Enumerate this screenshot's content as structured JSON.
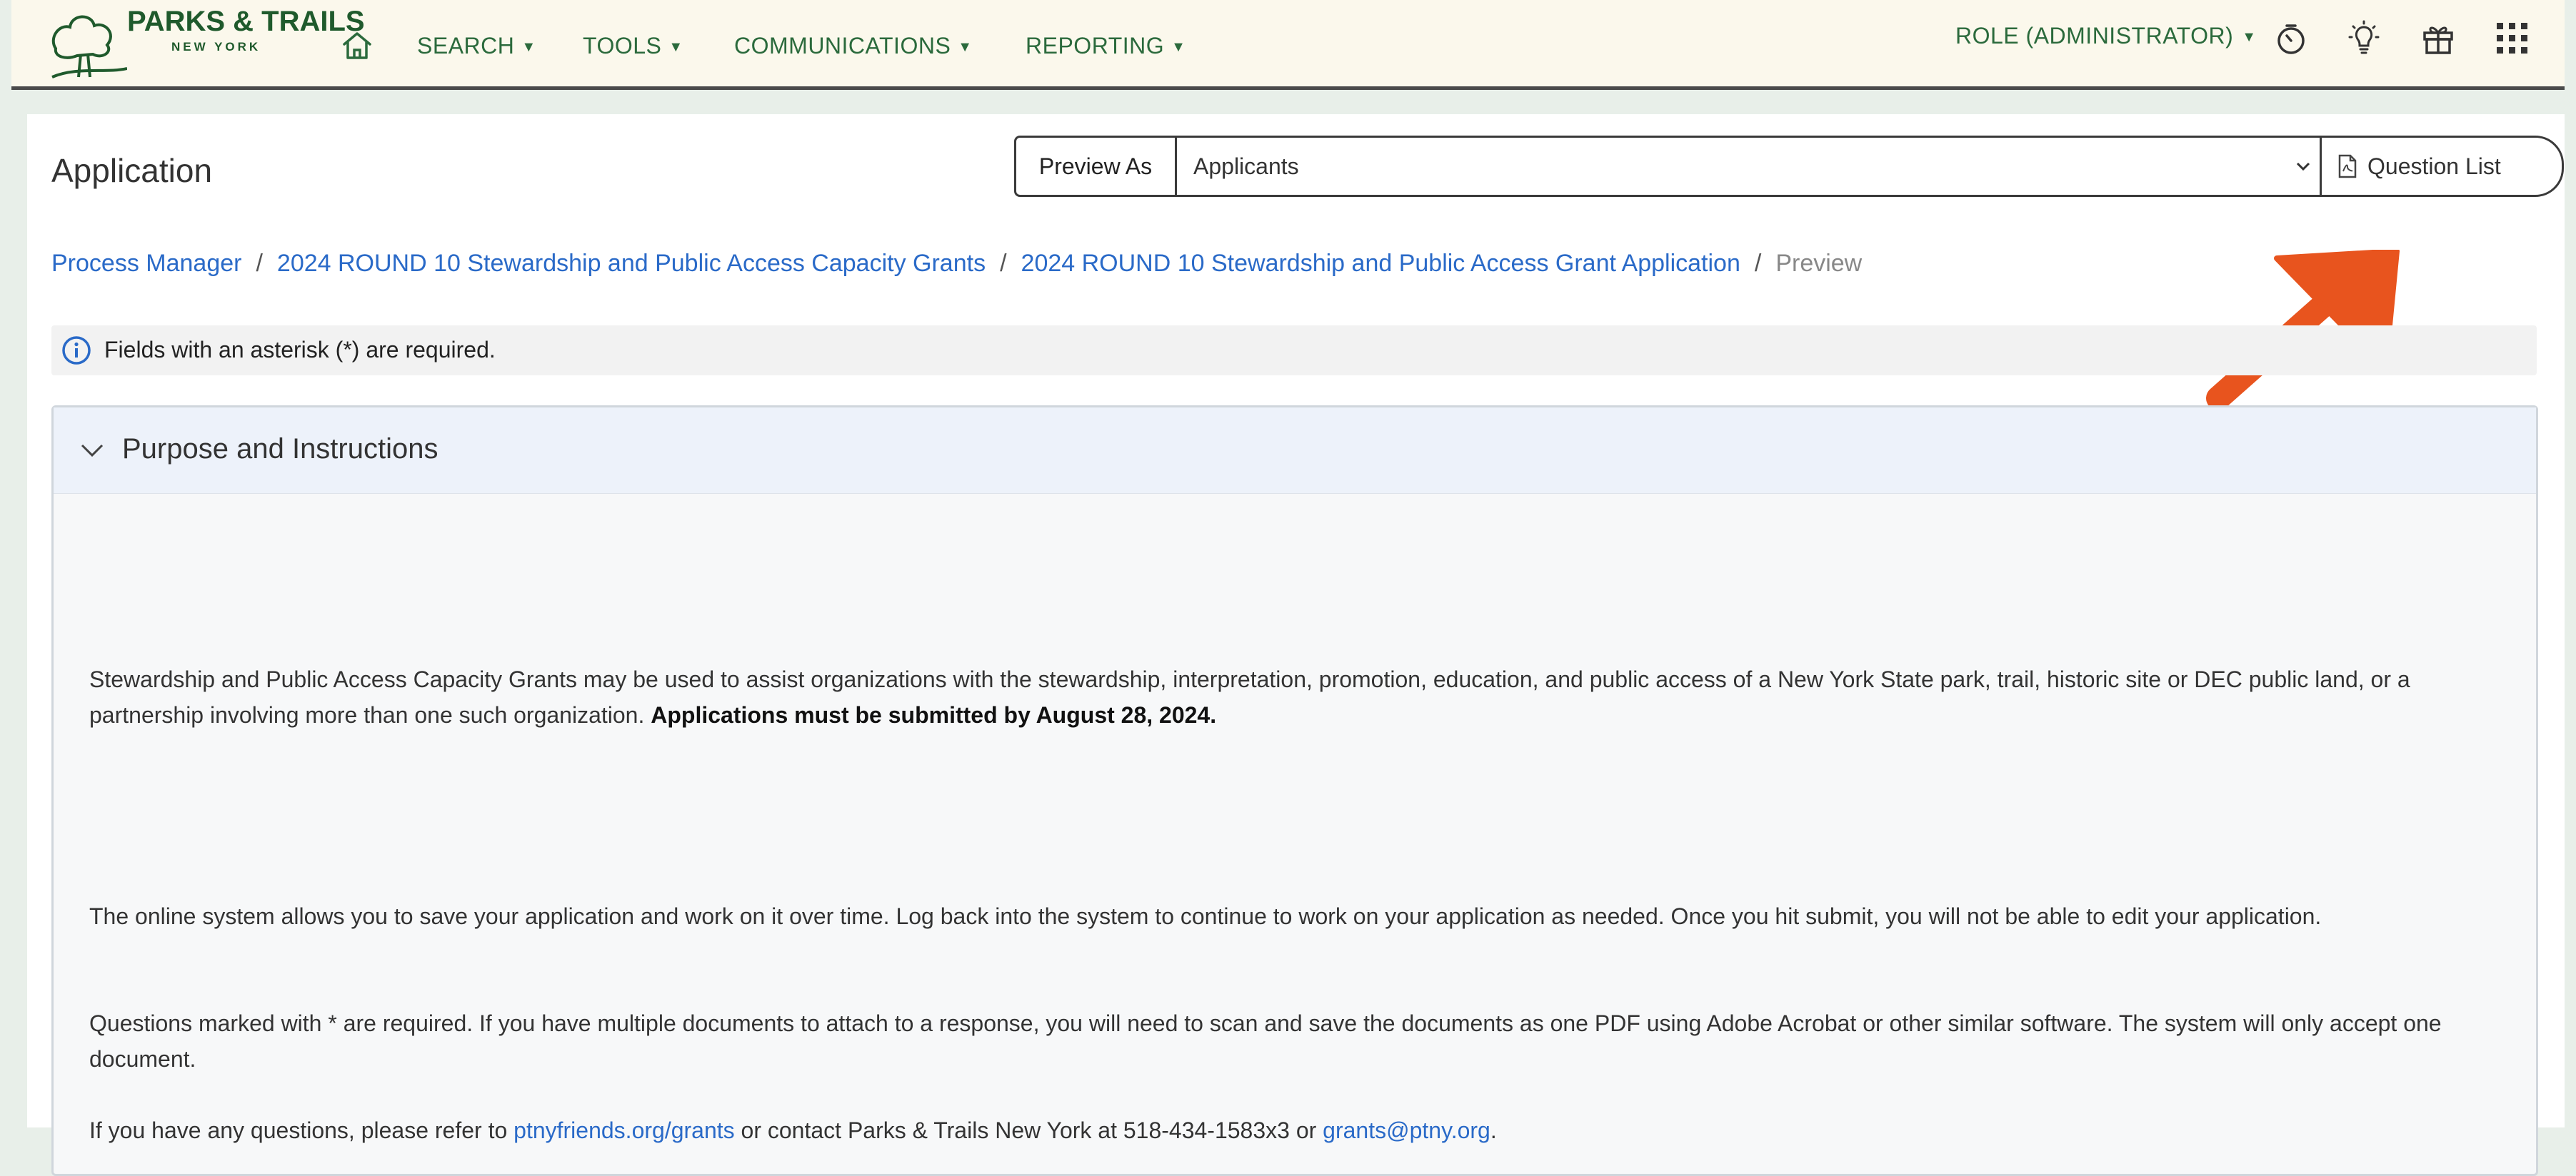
{
  "nav": {
    "logo_line1": "PARKS & TRAILS",
    "logo_line2": "NEW YORK",
    "items": [
      {
        "label": "SEARCH"
      },
      {
        "label": "TOOLS"
      },
      {
        "label": "COMMUNICATIONS"
      },
      {
        "label": "REPORTING"
      }
    ],
    "role_label": "ROLE (ADMINISTRATOR)",
    "icons": [
      "home-icon",
      "timer-icon",
      "lightbulb-icon",
      "gift-icon",
      "app-grid-icon"
    ]
  },
  "page": {
    "title": "Application",
    "preview_as_label": "Preview As",
    "preview_as_value": "Applicants",
    "question_list_label": "Question List"
  },
  "breadcrumb": [
    {
      "label": "Process Manager"
    },
    {
      "label": "2024 ROUND 10 Stewardship and Public Access Capacity Grants"
    },
    {
      "label": "2024 ROUND 10 Stewardship and Public Access Grant Application"
    },
    {
      "label": "Preview"
    }
  ],
  "notice": "Fields with an asterisk (*) are required.",
  "section": {
    "title": "Purpose and Instructions",
    "p1_text": "Stewardship and Public Access Capacity Grants may be used to assist organizations with the stewardship, interpretation, promotion, education, and public access of a New York State park, trail, historic site or DEC public land, or a partnership involving more than one such organization. ",
    "p1_bold": "Applications must be submitted by August 28, 2024.",
    "p2": "The online system allows you to save your application and work on it over time. Log back into the system to continue to work on your application as needed. Once you hit submit, you will not be able to edit your application.",
    "p3": "Questions marked with * are required. If you have multiple documents to attach to a response, you will need to scan and save the documents as one PDF using Adobe Acrobat or other similar software. The system will only accept one document.",
    "p4_pre": "If you have any questions, please refer to ",
    "p4_link1": "ptnyfriends.org/grants",
    "p4_mid": " or contact Parks & Trails New York at 518-434-1583x3 or ",
    "p4_link2": "grants@ptny.org",
    "p4_end": "."
  },
  "colors": {
    "nav_bg": "#fbf8ec",
    "nav_text": "#2b6a3c",
    "link": "#2a6ac8",
    "arrow": "#e8541e",
    "page_bg": "#e8efe9"
  }
}
